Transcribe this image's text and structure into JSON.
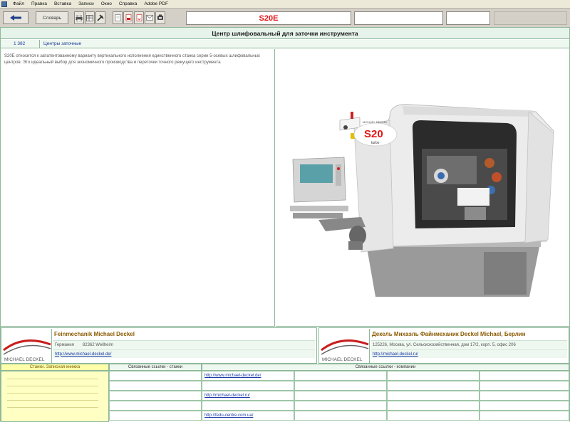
{
  "menu": {
    "items": [
      "Файл",
      "Правка",
      "Вставка",
      "Записи",
      "Окно",
      "Справка",
      "Adobe PDF"
    ]
  },
  "toolbar": {
    "back_icon": "back-arrow-icon",
    "dictionary_label": "Словарь",
    "record_title": "S20E"
  },
  "heading": "Центр шлифовальный для заточки инструмента",
  "category": {
    "code": "1 382",
    "name": "Центры заточные"
  },
  "description": "S20E относится к запатентованному варианту вертикального исполнения единственного станка серии 5-осевых шлифовальных центров. Это идеальный выбор для экономичного производства и переточки точного режущего инструмента",
  "photo": {
    "machine_badge": "S20",
    "machine_subtitle": "turbo",
    "brand_label": "MICHAEL DECKEL"
  },
  "vendor_left": {
    "logo_text": "MICHAEL DECKEL",
    "name": "Feinmechanik Michael Deckel",
    "country": "Германия",
    "address": "82362 Weilheim",
    "url": "http://www.michael-deckel.de/"
  },
  "vendor_right": {
    "logo_text": "MICHAEL DECKEL",
    "name": "Декель Михаэль Файнмеханик Deckel Michael, Берлин",
    "address": "125226, Москва, ул. Сельскохозяйственная, дом 17/2, корп. 5, офис 206",
    "url": "http://michael-deckel.ru/"
  },
  "bottom": {
    "col1_header": "Станки. Записная книжка",
    "col2_header": "Связанные ссылки - станки",
    "col3_header": "Связанные ссылки - компании",
    "links": [
      "http://www.michael-deckel.de/",
      "http://michael-deckel.ru/",
      "http://fedu-centre.com.ua/"
    ]
  },
  "colors": {
    "title_red": "#e21818",
    "vendor_brown": "#8a5a00",
    "link_blue": "#1a3aa8",
    "panel_green": "#eef7f0"
  }
}
